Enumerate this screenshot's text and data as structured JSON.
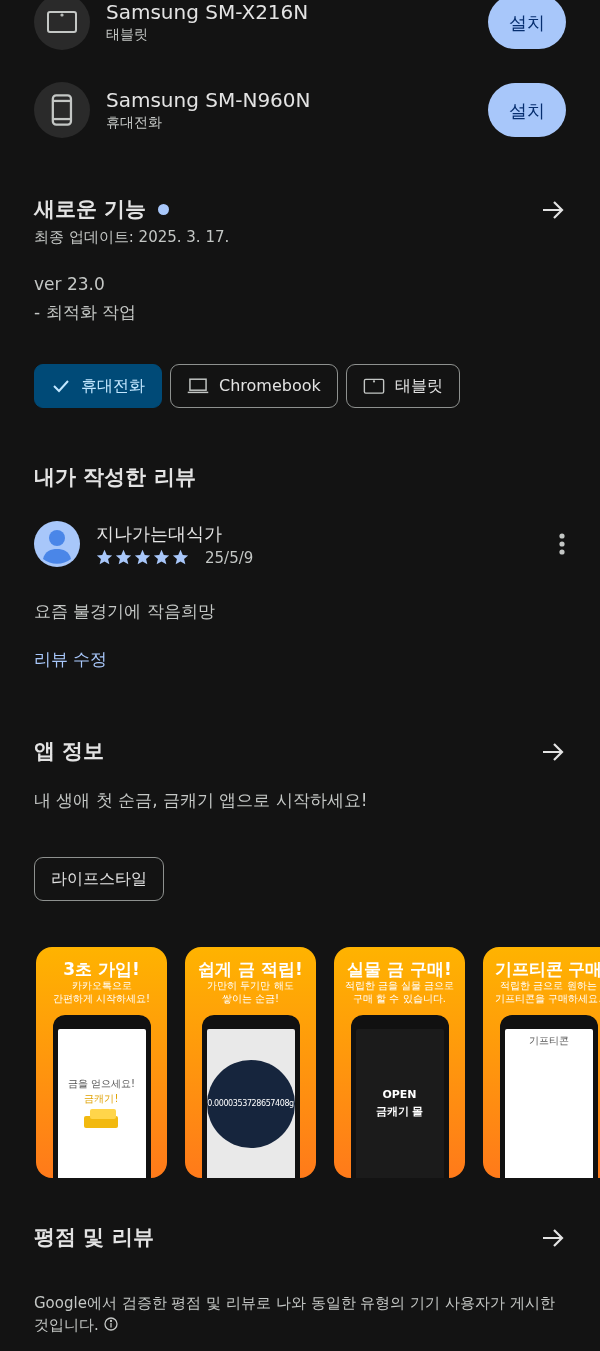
{
  "devices": [
    {
      "name": "Samsung SM-X216N",
      "type": "태블릿",
      "kind": "tablet",
      "button": "설치"
    },
    {
      "name": "Samsung SM-N960N",
      "type": "휴대전화",
      "kind": "phone",
      "button": "설치"
    }
  ],
  "whats_new": {
    "title": "새로운 기능",
    "unread": true,
    "updated": "최종 업데이트: 2025. 3. 17.",
    "notes": [
      "ver 23.0",
      "- 최적화 작업"
    ]
  },
  "device_filter": [
    {
      "label": "휴대전화",
      "selected": true
    },
    {
      "label": "Chromebook",
      "kind": "laptop",
      "selected": false
    },
    {
      "label": "태블릿",
      "kind": "tablet",
      "selected": false
    }
  ],
  "my_review": {
    "title": "내가 작성한 리뷰",
    "author": "지나가는대식가",
    "stars": 5,
    "date": "25/5/9",
    "text": "요즘 불경기에 작음희망",
    "edit_link": "리뷰 수정"
  },
  "app_info": {
    "title": "앱 정보",
    "description": "내 생애 첫 순금, 금캐기 앱으로 시작하세요!",
    "tags": [
      "라이프스타일"
    ]
  },
  "screenshots": [
    {
      "kind": "signup",
      "headline": "3초 가입!",
      "subtitle": [
        "카카오톡으로",
        "간편하게 시작하세요!"
      ],
      "screen_texts": [
        "금을 얻으세요!",
        "금캐기!"
      ]
    },
    {
      "kind": "savings",
      "headline": "쉽게 금 적립!",
      "subtitle": [
        "가만히 두기만 해도",
        "쌓이는 순금!"
      ],
      "screen_texts": [
        "0.0000353728657408g"
      ]
    },
    {
      "kind": "shop",
      "headline": "실물 금 구매!",
      "subtitle": [
        "적립한 금을 실물 금으로",
        "구매 할 수 있습니다."
      ],
      "screen_texts": [
        "OPEN",
        "금캐기 몰"
      ]
    },
    {
      "kind": "gifticon",
      "headline": "기프티콘 구매",
      "subtitle": [
        "적립한 금으로 원하는",
        "기프티콘을 구매하세요."
      ],
      "screen_texts": [
        "기프티콘"
      ]
    }
  ],
  "ratings": {
    "title": "평점 및 리뷰",
    "note": "Google에서 검증한 평점 및 리뷰로 나와 동일한 유형의 기기 사용자가 게시한 것입니다."
  }
}
